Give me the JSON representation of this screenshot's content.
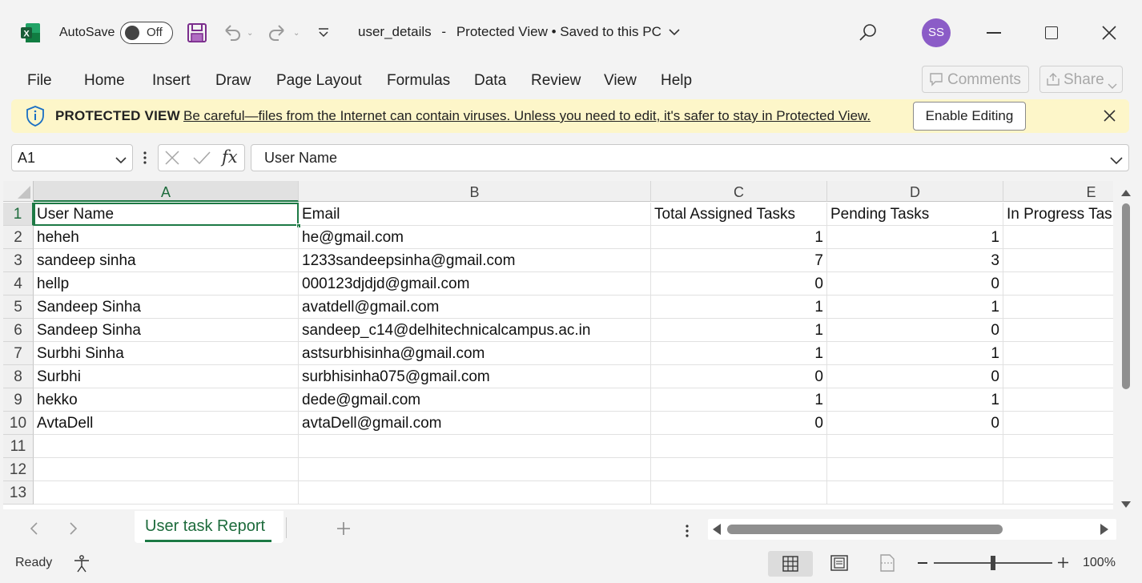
{
  "window": {
    "autosave_label": "AutoSave",
    "autosave_state": "Off",
    "file_name": "user_details",
    "separator": "-",
    "status": "Protected View • Saved to this PC",
    "user_initials": "SS"
  },
  "ribbon": {
    "tabs": [
      "File",
      "Home",
      "Insert",
      "Draw",
      "Page Layout",
      "Formulas",
      "Data",
      "Review",
      "View",
      "Help"
    ],
    "comments_label": "Comments",
    "share_label": "Share"
  },
  "protected_view": {
    "title": "PROTECTED VIEW",
    "message": "Be careful—files from the Internet can contain viruses. Unless you need to edit, it's safer to stay in Protected View.",
    "enable_label": "Enable Editing"
  },
  "formula_bar": {
    "name_box": "A1",
    "fx_label": "fx",
    "value": "User Name"
  },
  "grid": {
    "columns": [
      "A",
      "B",
      "C",
      "D",
      "E"
    ],
    "row_numbers": [
      "1",
      "2",
      "3",
      "4",
      "5",
      "6",
      "7",
      "8",
      "9",
      "10",
      "11",
      "12",
      "13"
    ],
    "header": [
      "User Name",
      "Email",
      "Total Assigned Tasks",
      "Pending Tasks",
      "In Progress Tas"
    ],
    "rows": [
      [
        "heheh",
        "he@gmail.com",
        "1",
        "1",
        ""
      ],
      [
        "sandeep sinha",
        "1233sandeepsinha@gmail.com",
        "7",
        "3",
        ""
      ],
      [
        "hellp",
        "000123djdjd@gmail.com",
        "0",
        "0",
        ""
      ],
      [
        "Sandeep Sinha",
        "avatdell@gmail.com",
        "1",
        "1",
        ""
      ],
      [
        "Sandeep Sinha",
        "sandeep_c14@delhitechnicalcampus.ac.in",
        "1",
        "0",
        ""
      ],
      [
        "Surbhi Sinha",
        "astsurbhisinha@gmail.com",
        "1",
        "1",
        ""
      ],
      [
        "Surbhi",
        "surbhisinha075@gmail.com",
        "0",
        "0",
        ""
      ],
      [
        "hekko",
        "dede@gmail.com",
        "1",
        "1",
        ""
      ],
      [
        "AvtaDell",
        "avtaDell@gmail.com",
        "0",
        "0",
        ""
      ]
    ]
  },
  "sheets": {
    "active": "User task Report"
  },
  "status_bar": {
    "ready": "Ready",
    "zoom": "100%"
  },
  "colors": {
    "excel_green": "#1d7a45",
    "protected_bg": "#fdf6c9",
    "avatar": "#8b5cc7"
  }
}
